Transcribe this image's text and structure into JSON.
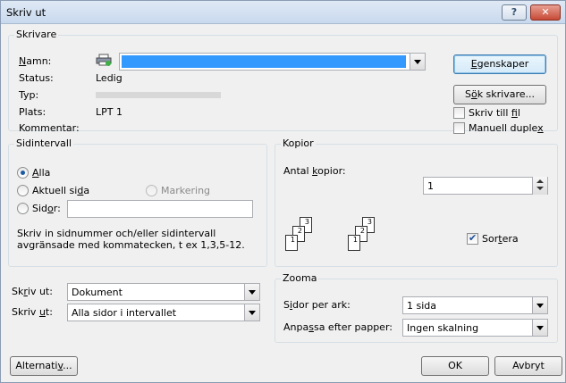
{
  "window": {
    "title": "Skriv ut",
    "help_label": "?",
    "close_label": "✕"
  },
  "printer": {
    "legend": "Skrivare",
    "name_label": "Namn:",
    "status_label": "Status:",
    "status_value": "Ledig",
    "type_label": "Typ:",
    "location_label": "Plats:",
    "location_value": "LPT 1",
    "comment_label": "Kommentar:",
    "properties_button": "Egenskaper",
    "find_printer_button": "Sök skrivare...",
    "print_to_file_label": "Skriv till fil",
    "manual_duplex_label": "Manuell duplex"
  },
  "range": {
    "legend": "Sidintervall",
    "all_label": "Alla",
    "current_label": "Aktuell sida",
    "selection_label": "Markering",
    "pages_label": "Sidor:",
    "hint": "Skriv in sidnummer och/eller sidintervall\navgränsade med kommatecken, t ex 1,3,5-12."
  },
  "copies": {
    "legend": "Kopior",
    "count_label": "Antal kopior:",
    "count_value": "1",
    "collate_label": "Sortera",
    "stack1": [
      "3",
      "2",
      "1"
    ],
    "stack2": [
      "3",
      "2",
      "1"
    ]
  },
  "print_what": {
    "label": "Skriv ut:",
    "value": "Dokument"
  },
  "print_pages": {
    "label": "Skriv ut:",
    "value": "Alla sidor i intervallet"
  },
  "zoom": {
    "legend": "Zooma",
    "pages_per_sheet_label": "Sidor per ark:",
    "pages_per_sheet_value": "1 sida",
    "scale_label": "Anpassa efter papper:",
    "scale_value": "Ingen skalning"
  },
  "footer": {
    "options_button": "Alternativ...",
    "ok_button": "OK",
    "cancel_button": "Avbryt"
  },
  "colors": {
    "selection": "#3399ff",
    "accent": "#1d5aa5"
  }
}
